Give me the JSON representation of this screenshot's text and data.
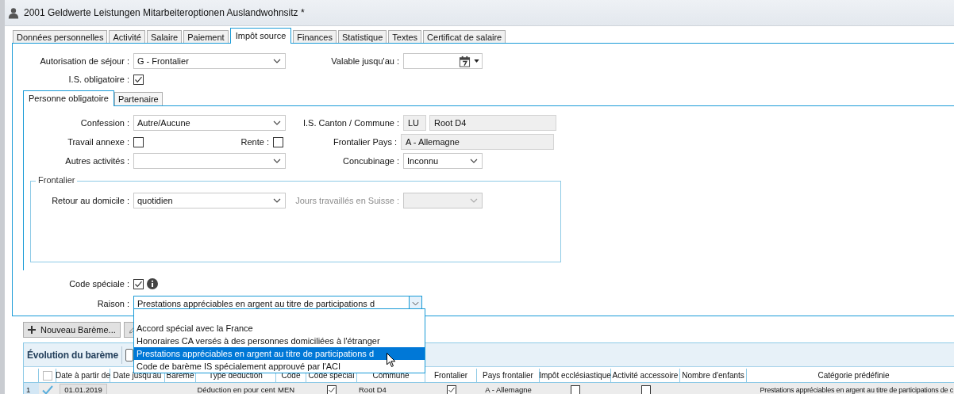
{
  "window": {
    "title": "2001 Geldwerte Leistungen Mitarbeiteroptionen Auslandwohnsitz *"
  },
  "tabs": [
    {
      "label": "Données personnelles",
      "selected": false
    },
    {
      "label": "Activité",
      "selected": false
    },
    {
      "label": "Salaire",
      "selected": false
    },
    {
      "label": "Paiement",
      "selected": false
    },
    {
      "label": "Impôt source",
      "selected": true
    },
    {
      "label": "Finances",
      "selected": false
    },
    {
      "label": "Statistique",
      "selected": false
    },
    {
      "label": "Textes",
      "selected": false
    },
    {
      "label": "Certificat de salaire",
      "selected": false
    }
  ],
  "residence": {
    "label": "Autorisation de séjour :",
    "value": "G - Frontalier"
  },
  "valid_until": {
    "label": "Valable jusqu'au :"
  },
  "is_obligatory": {
    "label": "I.S. obligatoire :",
    "checked": true
  },
  "subtabs": [
    {
      "label": "Personne obligatoire",
      "selected": true
    },
    {
      "label": "Partenaire",
      "selected": false
    }
  ],
  "confession": {
    "label": "Confession :",
    "value": "Autre/Aucune"
  },
  "canton_commune": {
    "label": "I.S. Canton / Commune :",
    "canton": "LU",
    "commune": "Root D4"
  },
  "side_job": {
    "label": "Travail annexe :",
    "checked": false
  },
  "pension": {
    "label": "Rente :",
    "checked": false
  },
  "border_country": {
    "label": "Frontalier Pays :",
    "value": "A - Allemagne"
  },
  "other_activities": {
    "label": "Autres activités :"
  },
  "concubinage": {
    "label": "Concubinage :",
    "value": "Inconnu"
  },
  "frontalier_group": {
    "title": "Frontalier",
    "return_home": {
      "label": "Retour au domicile :",
      "value": "quotidien"
    },
    "days_in_switzerland": {
      "label": "Jours travaillés en Suisse :",
      "disabled": true
    }
  },
  "special_code": {
    "label": "Code spéciale :",
    "checked": true
  },
  "reason": {
    "label": "Raison :",
    "value": "Prestations appréciables en argent au titre de participations d",
    "options": [
      {
        "label": "Accord spécial avec la France",
        "selected": false
      },
      {
        "label": "Honoraires CA versés à des personnes domiciliées à l'étranger",
        "selected": false
      },
      {
        "label": "Prestations appréciables en argent au titre de participations d",
        "selected": true
      },
      {
        "label": "Code de barème IS spécialement approuvé par l'ACI",
        "selected": false
      }
    ]
  },
  "toolbar": {
    "new_button": "Nouveau Barème..."
  },
  "grid": {
    "title": "Évolution du barème",
    "select_all": {
      "checked": false
    },
    "columns": [
      "Date à partir de",
      "Date jusqu'au",
      "Barème",
      "Type déduction",
      "Code",
      "Code spécial",
      "Commune",
      "Frontalier",
      "Pays frontalier",
      "Impôt ecclésiastique",
      "Activité accessoire",
      "Nombre d'enfants",
      "Catégorie prédéfinie"
    ],
    "rows": [
      {
        "number": "1",
        "validated": true,
        "cells": [
          {
            "kind": "date",
            "text": "01.01.2019"
          },
          {
            "kind": "empty"
          },
          {
            "kind": "empty"
          },
          {
            "kind": "text",
            "text": "Déduction en pour cent"
          },
          {
            "kind": "text",
            "text": "MEN"
          },
          {
            "kind": "check",
            "checked": true
          },
          {
            "kind": "text",
            "text": "Root D4"
          },
          {
            "kind": "check",
            "checked": true
          },
          {
            "kind": "text",
            "text": "A - Allemagne"
          },
          {
            "kind": "check",
            "checked": false
          },
          {
            "kind": "check",
            "checked": false
          },
          {
            "kind": "empty"
          },
          {
            "kind": "text",
            "text": "Prestations appréciables en argent au titre de participations de c"
          }
        ]
      }
    ]
  }
}
